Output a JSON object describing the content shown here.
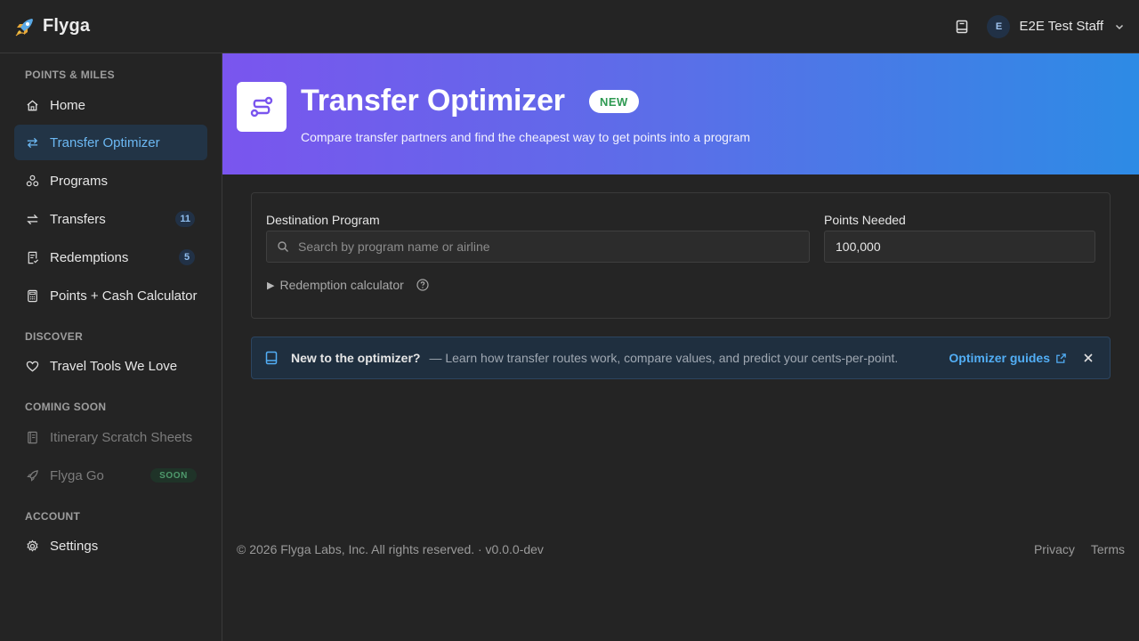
{
  "app": {
    "name": "Flyga"
  },
  "header": {
    "user_initial": "E",
    "user_name": "E2E Test Staff"
  },
  "sidebar": {
    "sections": {
      "points_miles": "POINTS & MILES",
      "discover": "DISCOVER",
      "coming_soon": "COMING SOON",
      "account": "ACCOUNT"
    },
    "items": {
      "home": "Home",
      "transfer_optimizer": "Transfer Optimizer",
      "programs": "Programs",
      "transfers": "Transfers",
      "transfers_count": "11",
      "redemptions": "Redemptions",
      "redemptions_count": "5",
      "points_cash": "Points + Cash Calculator",
      "travel_tools": "Travel Tools We Love",
      "itinerary": "Itinerary Scratch Sheets",
      "flyga_go": "Flyga Go",
      "soon_badge": "SOON",
      "settings": "Settings"
    }
  },
  "hero": {
    "title": "Transfer Optimizer",
    "badge": "NEW",
    "subtitle": "Compare transfer partners and find the cheapest way to get points into a program"
  },
  "form": {
    "destination_label": "Destination Program",
    "destination_placeholder": "Search by program name or airline",
    "points_label": "Points Needed",
    "points_value": "100,000",
    "calculator_toggle": "Redemption calculator"
  },
  "info": {
    "title": "New to the optimizer?",
    "text": "— Learn how transfer routes work, compare values, and predict your cents-per-point.",
    "link": "Optimizer guides"
  },
  "footer": {
    "copyright": "© 2026 Flyga Labs, Inc. All rights reserved. · v0.0.0-dev",
    "privacy": "Privacy",
    "terms": "Terms"
  },
  "colors": {
    "accent": "#6cb8f3",
    "hero_start": "#7a55ee",
    "hero_end": "#2d8be5",
    "new_badge": "#2f9a52"
  }
}
